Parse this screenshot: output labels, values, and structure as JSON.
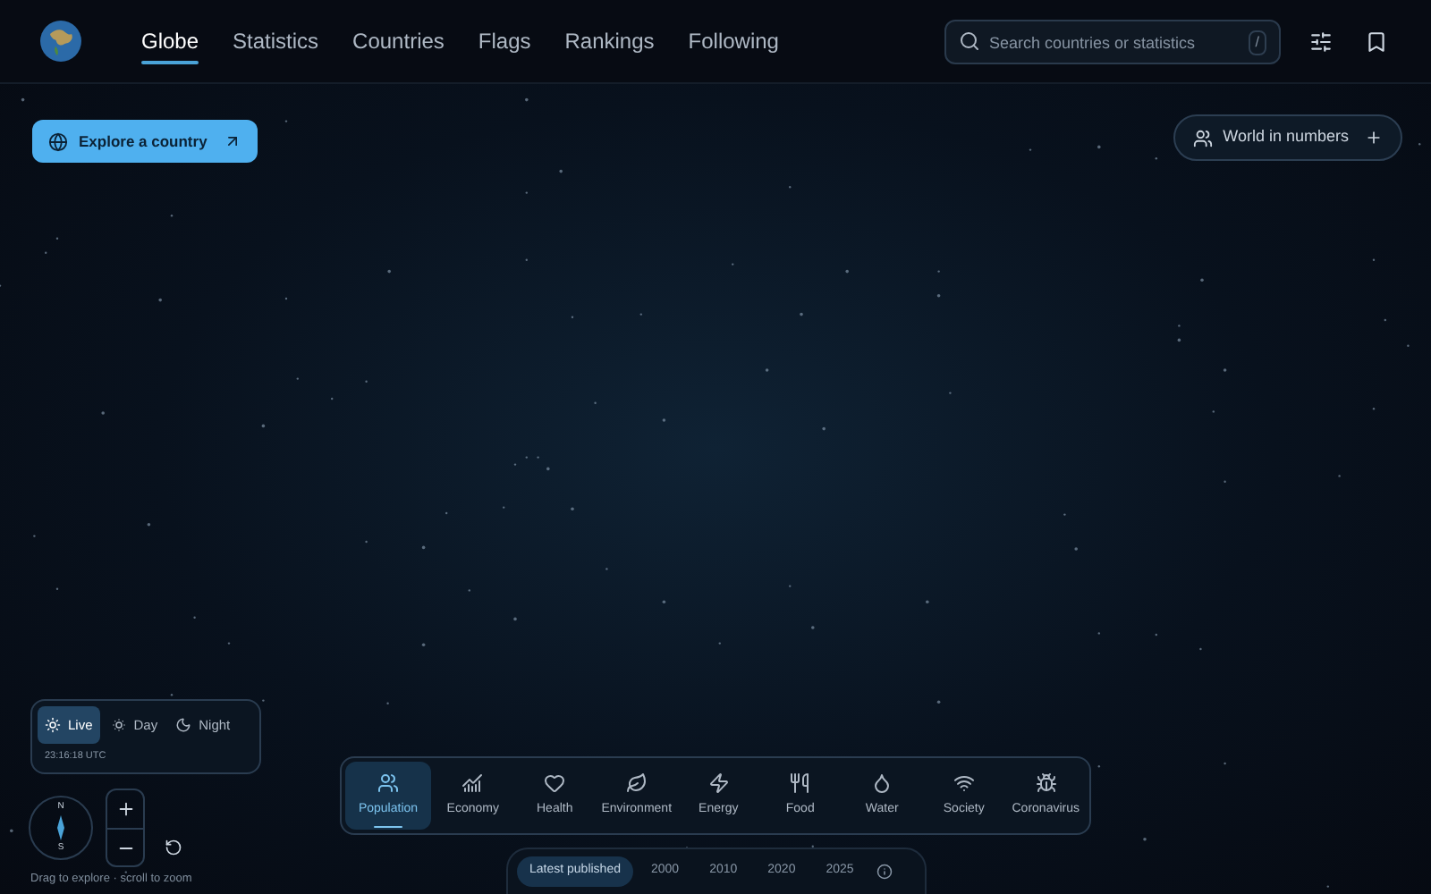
{
  "nav": [
    {
      "label": "Globe",
      "selected": true
    },
    {
      "label": "Statistics",
      "selected": false
    },
    {
      "label": "Countries",
      "selected": false
    },
    {
      "label": "Flags",
      "selected": false
    },
    {
      "label": "Rankings",
      "selected": false
    },
    {
      "label": "Following",
      "selected": false
    }
  ],
  "search": {
    "placeholder": "Search countries or statistics",
    "shortcut": "/"
  },
  "explore_button": "Explore a country",
  "world_button": "World in numbers",
  "time_modes": [
    {
      "label": "Live",
      "selected": true
    },
    {
      "label": "Day",
      "selected": false
    },
    {
      "label": "Night",
      "selected": false
    }
  ],
  "clock": "23:16:18 UTC",
  "compass": {
    "north": "N",
    "south": "S"
  },
  "hint": "Drag to explore · scroll to zoom",
  "categories": [
    {
      "label": "Population",
      "selected": true
    },
    {
      "label": "Economy",
      "selected": false
    },
    {
      "label": "Health",
      "selected": false
    },
    {
      "label": "Environment",
      "selected": false
    },
    {
      "label": "Energy",
      "selected": false
    },
    {
      "label": "Food",
      "selected": false
    },
    {
      "label": "Water",
      "selected": false
    },
    {
      "label": "Society",
      "selected": false
    },
    {
      "label": "Coronavirus",
      "selected": false
    }
  ],
  "years": [
    {
      "label": "Latest published",
      "selected": true
    },
    {
      "label": "2000",
      "selected": false
    },
    {
      "label": "2010",
      "selected": false
    },
    {
      "label": "2020",
      "selected": false
    },
    {
      "label": "2025",
      "selected": false
    }
  ]
}
